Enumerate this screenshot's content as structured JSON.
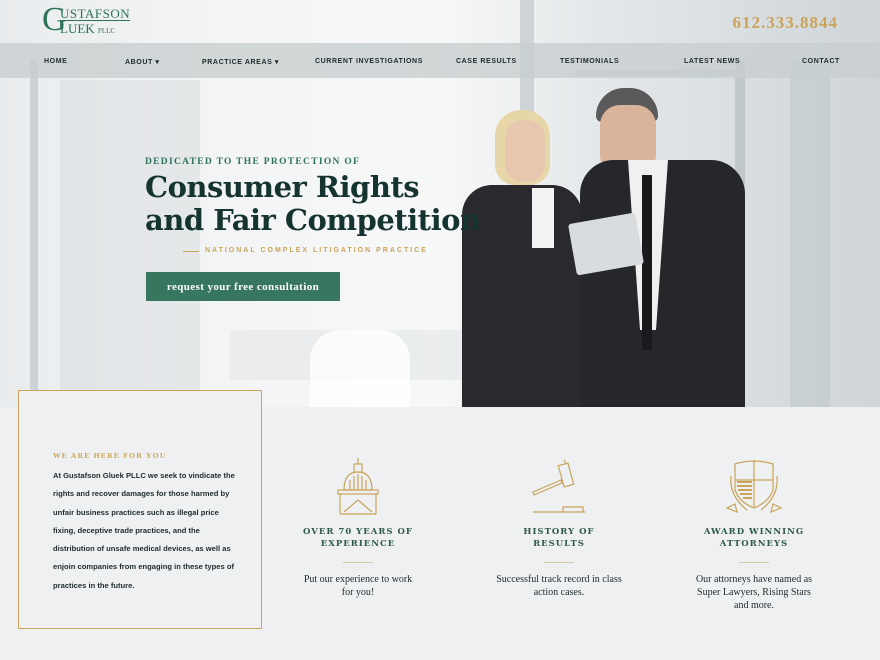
{
  "header": {
    "logo_initial1": "G",
    "logo_line1": "USTAFSON",
    "logo_line2": "LUEK",
    "logo_suffix": "PLLC",
    "phone": "612.333.8844"
  },
  "nav": {
    "items": [
      {
        "label": "HOME"
      },
      {
        "label": "ABOUT ▾"
      },
      {
        "label": "PRACTICE AREAS ▾"
      },
      {
        "label": "CURRENT INVESTIGATIONS"
      },
      {
        "label": "CASE RESULTS"
      },
      {
        "label": "TESTIMONIALS"
      },
      {
        "label": "LATEST NEWS"
      },
      {
        "label": "CONTACT"
      }
    ]
  },
  "hero": {
    "kicker": "DEDICATED TO THE PROTECTION OF",
    "title": "Consumer Rights and Fair Competition",
    "subtitle": "NATIONAL COMPLEX LITIGATION PRACTICE",
    "cta": "request your free consultation"
  },
  "intro": {
    "heading": "WE ARE HERE FOR YOU",
    "body": "At Gustafson Gluek PLLC we seek to vindicate the rights and recover damages for those harmed by unfair business practices such as illegal price fixing, deceptive trade practices, and the distribution of unsafe medical devices, as well as enjoin companies from engaging in these types of practices in the future."
  },
  "features": [
    {
      "icon": "capitol-dome-icon",
      "title1": "OVER 70 YEARS OF",
      "title2": "EXPERIENCE",
      "text": "Put our experience to work for you!"
    },
    {
      "icon": "gavel-icon",
      "title1": "HISTORY OF",
      "title2": "RESULTS",
      "text": "Successful track record in class action cases."
    },
    {
      "icon": "shield-crest-icon",
      "title1": "AWARD WINNING",
      "title2": "ATTORNEYS",
      "text": "Our attorneys have named as Super Lawyers, Rising Stars and more."
    }
  ],
  "colors": {
    "green": "#37765f",
    "gold": "#c9a45a",
    "dark": "#153330"
  }
}
